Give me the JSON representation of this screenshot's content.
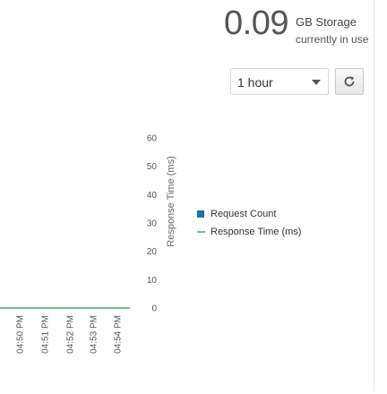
{
  "storage": {
    "value": "0.09",
    "unit": "GB Storage",
    "subtitle": "currently in use"
  },
  "time_range": {
    "selected": "1 hour"
  },
  "refresh": {
    "icon": "refresh-icon"
  },
  "colors": {
    "request_count": "#1f6fa8",
    "response_time": "#6cbf8e",
    "text": "#555555"
  },
  "legend": {
    "items": [
      {
        "label": "Request Count",
        "icon": "square-swatch"
      },
      {
        "label": "Response Time (ms)",
        "icon": "line-swatch"
      }
    ]
  },
  "chart_data": {
    "type": "line",
    "x": [
      "04:50 PM",
      "04:51 PM",
      "04:52 PM",
      "04:53 PM",
      "04:54 PM"
    ],
    "ylabel": "Response Time (ms)",
    "ylim": [
      0,
      60
    ],
    "y_ticks": [
      0,
      10,
      20,
      30,
      40,
      50,
      60
    ],
    "series": [
      {
        "name": "Response Time (ms)",
        "values": [
          0,
          0,
          0,
          0,
          0
        ]
      }
    ],
    "grid": false,
    "legend_position": "right"
  }
}
